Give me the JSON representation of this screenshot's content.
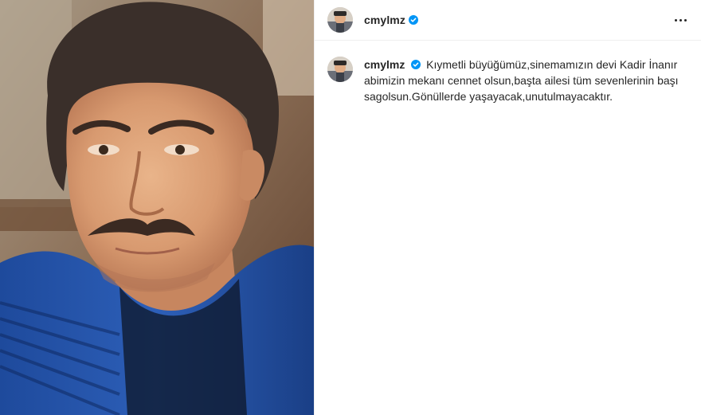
{
  "post": {
    "username": "cmylmz",
    "verified": true,
    "caption": "Kıymetli büyüğümüz,sinemamızın devi Kadir İnanır abimizin mekanı cennet olsun,başta ailesi tüm sevenlerinin başı sagolsun.Gönüllerde yaşayacak,unutulmayacaktır."
  },
  "icons": {
    "verified": "verified-badge-icon",
    "more": "more-options-icon"
  },
  "colors": {
    "verified_blue": "#0095f6",
    "text": "#262626",
    "divider": "#efefef"
  }
}
